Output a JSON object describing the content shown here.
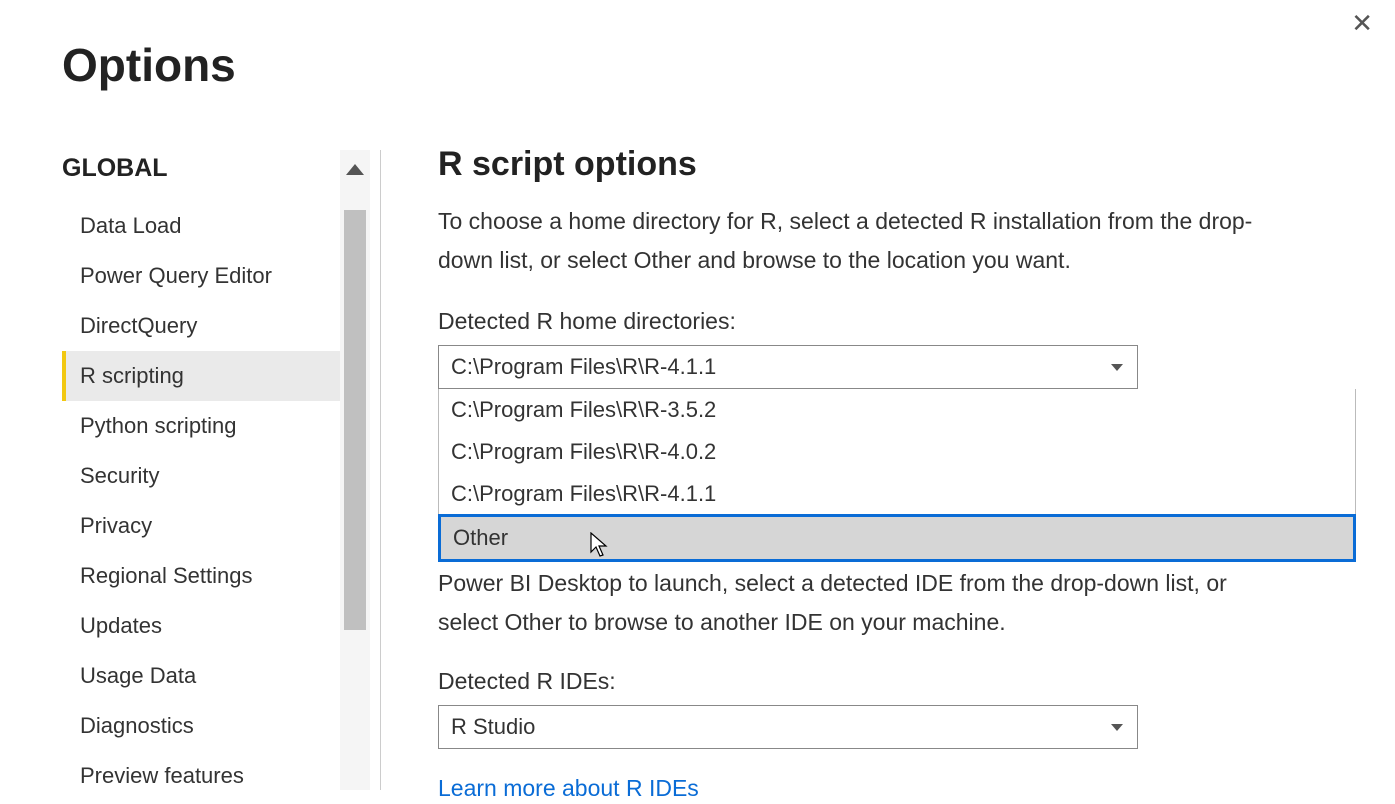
{
  "window": {
    "title": "Options"
  },
  "sidebar": {
    "section_header": "GLOBAL",
    "items": [
      {
        "label": "Data Load"
      },
      {
        "label": "Power Query Editor"
      },
      {
        "label": "DirectQuery"
      },
      {
        "label": "R scripting",
        "selected": true
      },
      {
        "label": "Python scripting"
      },
      {
        "label": "Security"
      },
      {
        "label": "Privacy"
      },
      {
        "label": "Regional Settings"
      },
      {
        "label": "Updates"
      },
      {
        "label": "Usage Data"
      },
      {
        "label": "Diagnostics"
      },
      {
        "label": "Preview features"
      }
    ]
  },
  "content": {
    "heading": "R script options",
    "description": "To choose a home directory for R, select a detected R installation from the drop-down list, or select Other and browse to the location you want.",
    "home_dir_label": "Detected R home directories:",
    "home_dir_selected": "C:\\Program Files\\R\\R-4.1.1",
    "home_dir_options": [
      "C:\\Program Files\\R\\R-3.5.2",
      "C:\\Program Files\\R\\R-4.0.2",
      "C:\\Program Files\\R\\R-4.1.1",
      "Other"
    ],
    "ide_partial_text_top": "Power BI Desktop to launch, select a detected IDE from the drop-down list, or",
    "ide_partial_text_bottom": "select Other to browse to another IDE on your machine.",
    "ide_label": "Detected R IDEs:",
    "ide_selected": "R Studio",
    "ide_link": "Learn more about R IDEs"
  }
}
